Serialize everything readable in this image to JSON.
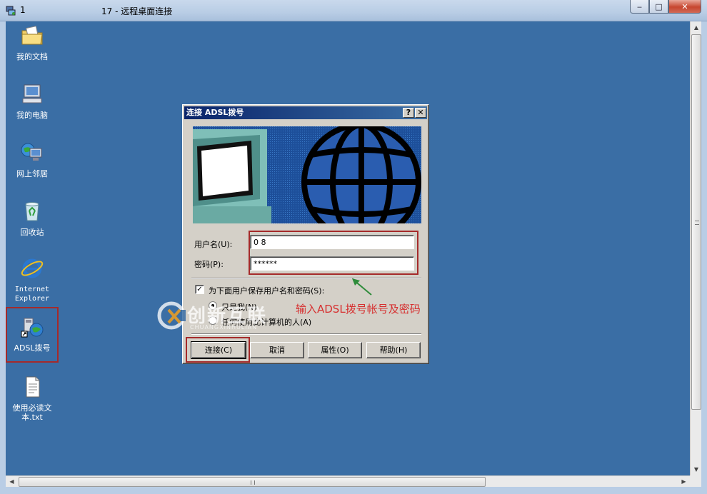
{
  "window": {
    "session_number": "1",
    "title": "17 - 远程桌面连接",
    "minimize": "‒",
    "maximize": "□",
    "close": "✕"
  },
  "desktop_icons": [
    {
      "name": "my-documents",
      "label": "我的文档",
      "icon": "folder-icon"
    },
    {
      "name": "my-computer",
      "label": "我的电脑",
      "icon": "computer-icon"
    },
    {
      "name": "network-places",
      "label": "网上邻居",
      "icon": "network-icon"
    },
    {
      "name": "recycle-bin",
      "label": "回收站",
      "icon": "recycle-bin-icon"
    },
    {
      "name": "internet-explorer",
      "label": "Internet Explorer",
      "icon": "ie-icon"
    },
    {
      "name": "adsl-dialup",
      "label": "ADSL拨号",
      "icon": "dialup-icon"
    },
    {
      "name": "readme-txt",
      "label": "使用必读文本.txt",
      "icon": "text-file-icon"
    }
  ],
  "dialog": {
    "title": "连接 ADSL拨号",
    "help_btn": "?",
    "close_btn": "✕",
    "username_label": "用户名(U):",
    "username_value": "0          8",
    "password_label": "密码(P):",
    "password_value": "******",
    "save_checkbox_label": "为下面用户保存用户名和密码(S):",
    "save_checked": true,
    "radio_me_only": "只是我(N)",
    "radio_anyone": "任何使用此计算机的人(A)",
    "buttons": {
      "connect": "连接(C)",
      "cancel": "取消",
      "properties": "属性(O)",
      "help": "帮助(H)"
    }
  },
  "annotation": {
    "text": "输入ADSL拨号帐号及密码",
    "color": "#d62f2f"
  },
  "watermark": {
    "text": "创新互联",
    "sub": "CHUANGXINHULIAN"
  },
  "colors": {
    "desktop_bg": "#3a6ea5",
    "dialog_bg": "#d4d0c8",
    "title_active": "#0a246a",
    "highlight_box": "#a52a2a"
  }
}
